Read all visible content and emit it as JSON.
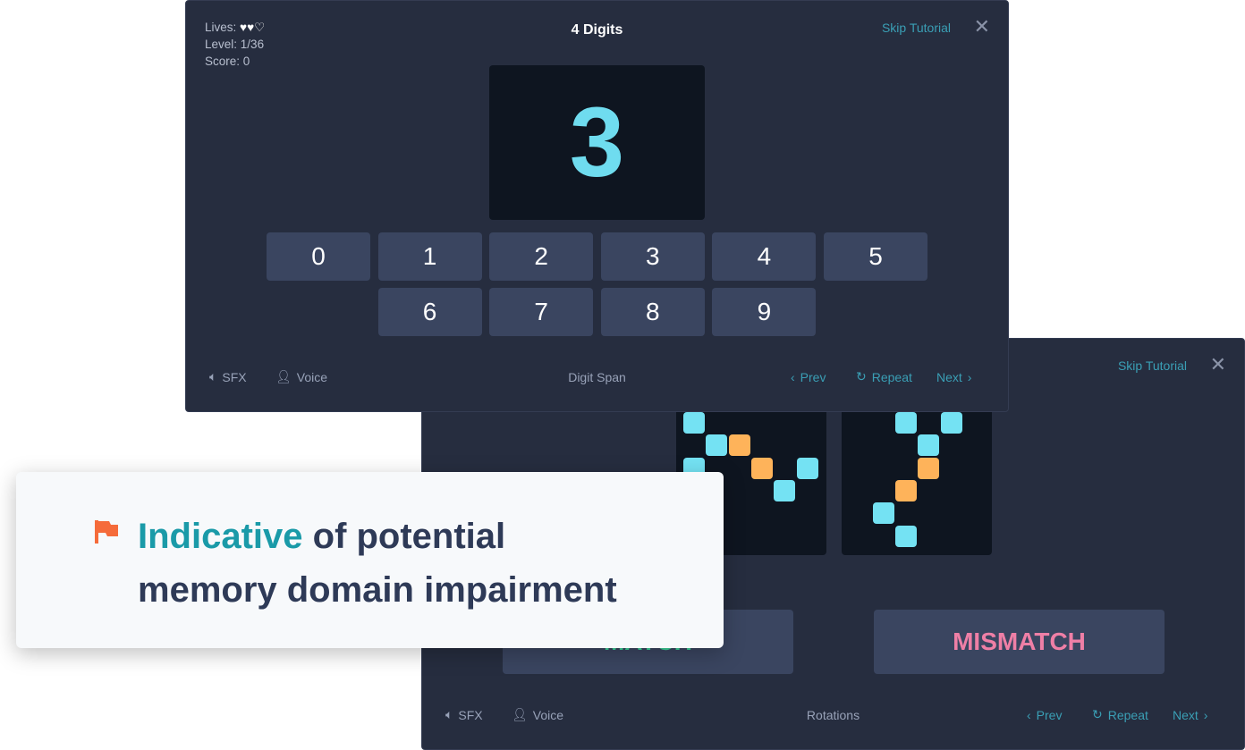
{
  "digit_span": {
    "lives_label": "Lives:",
    "lives": {
      "total": 3,
      "remaining": 2
    },
    "level_label": "Level:",
    "level": "1/36",
    "score_label": "Score:",
    "score": "0",
    "title": "4 Digits",
    "skip": "Skip Tutorial",
    "display_digit": "3",
    "keys": [
      "0",
      "1",
      "2",
      "3",
      "4",
      "5",
      "6",
      "7",
      "8",
      "9"
    ],
    "footer": {
      "sfx": "SFX",
      "voice": "Voice",
      "game": "Digit Span",
      "prev": "Prev",
      "repeat": "Repeat",
      "next": "Next"
    }
  },
  "rotations": {
    "skip": "Skip Tutorial",
    "match": "MATCH",
    "mismatch": "MISMATCH",
    "grid_left": [
      [
        0,
        0,
        "cyan"
      ],
      [
        1,
        1,
        "cyan"
      ],
      [
        2,
        1,
        "orange"
      ],
      [
        0,
        2,
        "cyan"
      ],
      [
        3,
        2,
        "orange"
      ],
      [
        5,
        2,
        "cyan"
      ],
      [
        4,
        3,
        "cyan"
      ]
    ],
    "grid_right": [
      [
        3,
        0,
        "cyan"
      ],
      [
        5,
        0,
        "cyan"
      ],
      [
        4,
        1,
        "cyan"
      ],
      [
        4,
        2,
        "orange"
      ],
      [
        3,
        3,
        "orange"
      ],
      [
        2,
        4,
        "cyan"
      ],
      [
        3,
        5,
        "cyan"
      ]
    ],
    "footer": {
      "sfx": "SFX",
      "voice": "Voice",
      "game": "Rotations",
      "prev": "Prev",
      "repeat": "Repeat",
      "next": "Next"
    }
  },
  "callout": {
    "highlight": "Indicative",
    "rest1": " of potential",
    "line2": "memory domain impairment"
  },
  "colors": {
    "cyan": "#74e2f3",
    "orange": "#feb35a",
    "teal": "#1a9aa8",
    "match": "#3ed39b",
    "mismatch": "#ef7fa6",
    "flag": "#f56b3a"
  }
}
